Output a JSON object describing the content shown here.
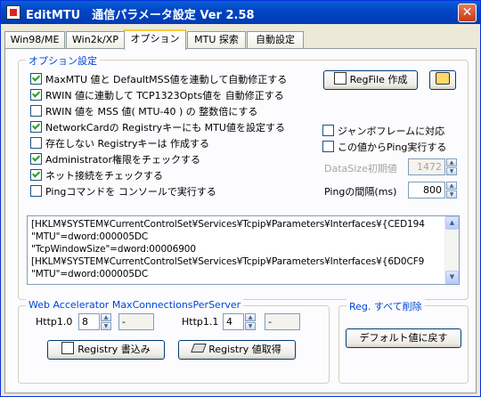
{
  "window": {
    "title": "EditMTU　通信パラメータ設定 Ver 2.58",
    "close_glyph": "✕"
  },
  "tabs": [
    {
      "label": "Win98/ME"
    },
    {
      "label": "Win2k/XP"
    },
    {
      "label": "オプション"
    },
    {
      "label": "MTU 探索"
    },
    {
      "label": "自動設定"
    }
  ],
  "options": {
    "legend": "オプション設定",
    "checkboxes": [
      {
        "label": "MaxMTU 値と DefaultMSS値を連動して自動修正する",
        "checked": true
      },
      {
        "label": "RWIN 値に連動して TCP1323Opts値を 自動修正する",
        "checked": true
      },
      {
        "label": "RWIN 値を MSS 値( MTU-40 ) の 整数倍にする",
        "checked": false
      },
      {
        "label": "NetworkCardの Registryキーにも MTU値を設定する",
        "checked": true
      },
      {
        "label": "存在しない Registryキーは 作成する",
        "checked": false
      },
      {
        "label": "Administrator権限をチェックする",
        "checked": true
      },
      {
        "label": "ネット接続をチェックする",
        "checked": true
      },
      {
        "label": "Pingコマンドを コンソールで実行する",
        "checked": false
      }
    ],
    "regfile_button": "RegFile 作成",
    "jumbo_label": "ジャンボフレームに対応",
    "ping_from_label": "この値からPing実行する",
    "datasize_label": "DataSize初期値",
    "datasize_value": "1472",
    "ping_interval_label": "Pingの間隔(ms)",
    "ping_interval_value": "800"
  },
  "registry_text": [
    "[HKLM¥SYSTEM¥CurrentControlSet¥Services¥Tcpip¥Parameters¥Interfaces¥{CED194",
    "\"MTU\"=dword:000005DC",
    "\"TcpWindowSize\"=dword:00006900",
    "[HKLM¥SYSTEM¥CurrentControlSet¥Services¥Tcpip¥Parameters¥Interfaces¥{6D0CF9",
    "\"MTU\"=dword:000005DC"
  ],
  "web_accel": {
    "legend": "Web Accelerator MaxConnectionsPerServer",
    "http10_label": "Http1.0",
    "http10_value": "8",
    "http10_extra": "-",
    "http11_label": "Http1.1",
    "http11_value": "4",
    "http11_extra": "-",
    "registry_write_button": "Registry 書込み",
    "registry_read_button": "Registry 値取得"
  },
  "reg_delete": {
    "legend": "Reg. すべて削除",
    "default_button": "デフォルト値に戻す"
  }
}
